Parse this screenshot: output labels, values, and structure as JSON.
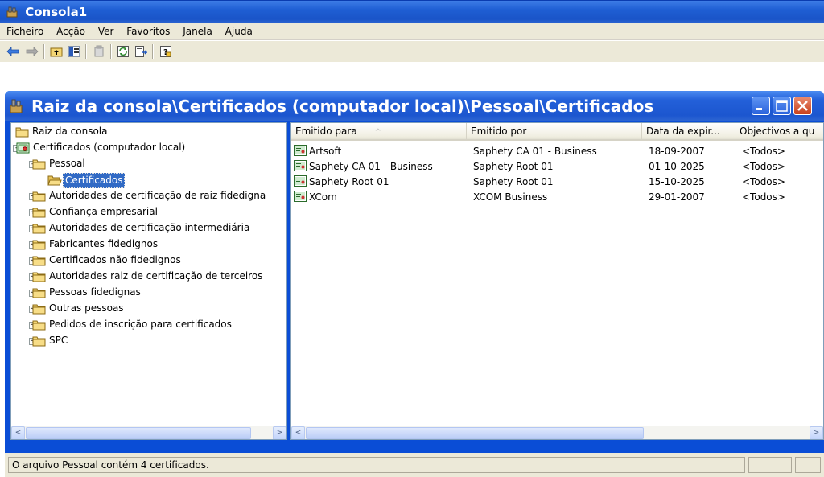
{
  "app": {
    "title": "Consola1"
  },
  "menu": [
    "Ficheiro",
    "Acção",
    "Ver",
    "Favoritos",
    "Janela",
    "Ajuda"
  ],
  "child_window": {
    "title": "Raiz da consola\\Certificados (computador local)\\Pessoal\\Certificados"
  },
  "tree": [
    {
      "label": "Raiz da consola",
      "level": 0,
      "expander": "",
      "selected": false
    },
    {
      "label": "Certificados (computador local)",
      "level": 1,
      "expander": "-",
      "selected": false
    },
    {
      "label": "Pessoal",
      "level": 2,
      "expander": "-",
      "selected": false
    },
    {
      "label": "Certificados",
      "level": 3,
      "expander": "",
      "selected": true
    },
    {
      "label": "Autoridades de certificação de raiz fidedigna",
      "level": 2,
      "expander": "+",
      "selected": false
    },
    {
      "label": "Confiança empresarial",
      "level": 2,
      "expander": "+",
      "selected": false
    },
    {
      "label": "Autoridades de certificação intermediária",
      "level": 2,
      "expander": "+",
      "selected": false
    },
    {
      "label": "Fabricantes fidedignos",
      "level": 2,
      "expander": "+",
      "selected": false
    },
    {
      "label": "Certificados não fidedignos",
      "level": 2,
      "expander": "+",
      "selected": false
    },
    {
      "label": "Autoridades raiz de certificação de terceiros",
      "level": 2,
      "expander": "+",
      "selected": false
    },
    {
      "label": "Pessoas fidedignas",
      "level": 2,
      "expander": "+",
      "selected": false
    },
    {
      "label": "Outras pessoas",
      "level": 2,
      "expander": "+",
      "selected": false
    },
    {
      "label": "Pedidos de inscrição para certificados",
      "level": 2,
      "expander": "+",
      "selected": false
    },
    {
      "label": "SPC",
      "level": 2,
      "expander": "+",
      "selected": false
    }
  ],
  "list": {
    "columns": [
      "Emitido para",
      "Emitido por",
      "Data da expir...",
      "Objectivos a qu"
    ],
    "sort_indicator": "^",
    "rows": [
      [
        "Artsoft",
        "Saphety CA 01 - Business",
        "18-09-2007",
        "<Todos>"
      ],
      [
        "Saphety CA 01 - Business",
        "Saphety Root 01",
        "01-10-2025",
        "<Todos>"
      ],
      [
        "Saphety Root 01",
        "Saphety Root 01",
        "15-10-2025",
        "<Todos>"
      ],
      [
        "XCom",
        "XCOM Business",
        "29-01-2007",
        "<Todos>"
      ]
    ]
  },
  "status": {
    "text": "O arquivo Pessoal contém 4 certificados."
  }
}
